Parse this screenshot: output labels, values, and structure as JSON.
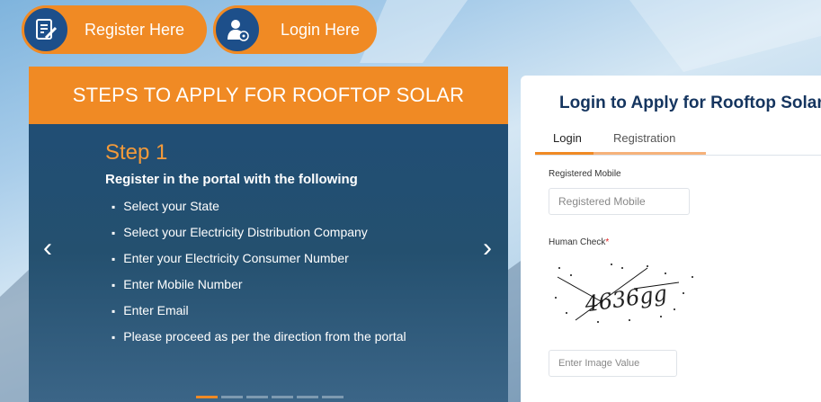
{
  "top_buttons": {
    "register": {
      "label": "Register Here",
      "icon": "document-edit-icon"
    },
    "login": {
      "label": "Login Here",
      "icon": "user-lock-icon"
    }
  },
  "steps_panel": {
    "heading": "STEPS TO APPLY FOR ROOFTOP SOLAR",
    "step_title": "Step 1",
    "step_subtitle": "Register in the portal with the following",
    "items": [
      "Select your State",
      "Select your Electricity Distribution Company",
      "Enter your Electricity Consumer Number",
      "Enter Mobile Number",
      "Enter Email",
      "Please proceed as per the direction from the portal"
    ],
    "prev_arrow": "‹",
    "next_arrow": "›",
    "slide_count": 6,
    "active_slide": 1
  },
  "login_card": {
    "title": "Login to Apply for Rooftop Solar",
    "tabs": [
      "Login",
      "Registration"
    ],
    "active_tab": "Login",
    "mobile_label": "Registered Mobile",
    "mobile_placeholder": "Registered Mobile",
    "human_check_label": "Human Check",
    "required_mark": "*",
    "captcha_text": "4636gg",
    "image_value_placeholder": "Enter Image Value"
  },
  "colors": {
    "accent_orange": "#f08a24",
    "panel_blue": "#1f4a72",
    "title_navy": "#15355f"
  }
}
